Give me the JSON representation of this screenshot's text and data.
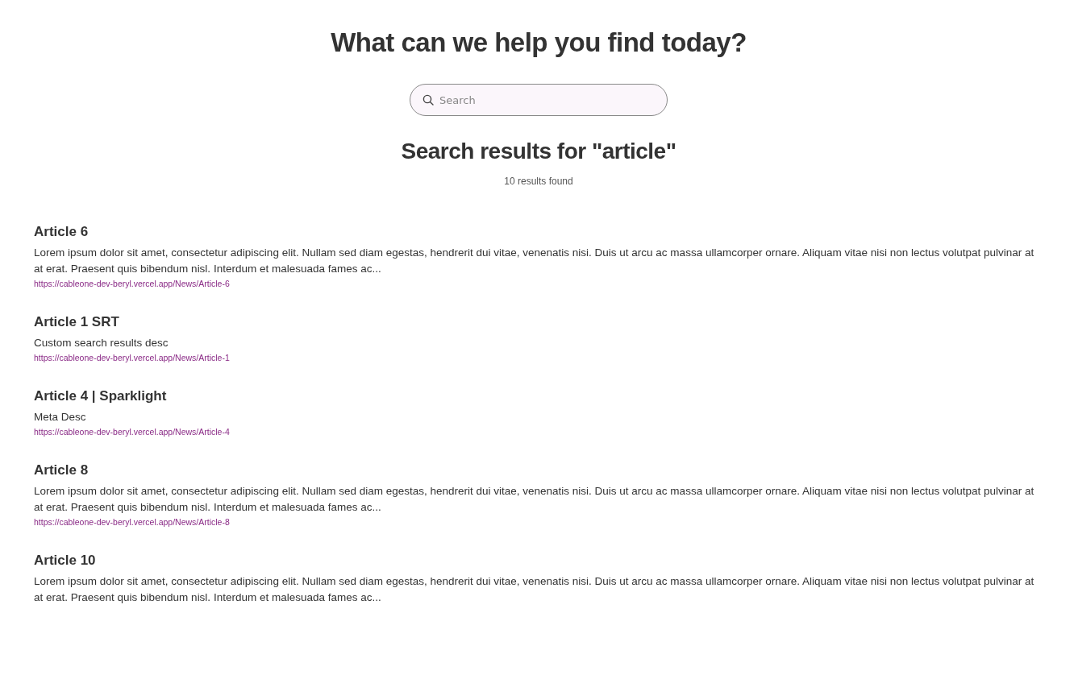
{
  "heading": "What can we help you find today?",
  "search": {
    "placeholder": "Search"
  },
  "results_heading": "Search results for \"article\"",
  "results_count": "10 results found",
  "results": [
    {
      "title": "Article 6",
      "description": "Lorem ipsum dolor sit amet, consectetur adipiscing elit. Nullam sed diam egestas, hendrerit dui vitae, venenatis nisi. Duis ut arcu ac massa ullamcorper ornare. Aliquam vitae nisi non lectus volutpat pulvinar at at erat. Praesent quis bibendum nisl. Interdum et malesuada fames ac...",
      "url": "https://cableone-dev-beryl.vercel.app/News/Article-6"
    },
    {
      "title": "Article 1 SRT",
      "description": "Custom search results desc",
      "url": "https://cableone-dev-beryl.vercel.app/News/Article-1"
    },
    {
      "title": "Article 4 | Sparklight",
      "description": "Meta Desc",
      "url": "https://cableone-dev-beryl.vercel.app/News/Article-4"
    },
    {
      "title": "Article 8",
      "description": "Lorem ipsum dolor sit amet, consectetur adipiscing elit. Nullam sed diam egestas, hendrerit dui vitae, venenatis nisi. Duis ut arcu ac massa ullamcorper ornare. Aliquam vitae nisi non lectus volutpat pulvinar at at erat. Praesent quis bibendum nisl. Interdum et malesuada fames ac...",
      "url": "https://cableone-dev-beryl.vercel.app/News/Article-8"
    },
    {
      "title": "Article 10",
      "description": "Lorem ipsum dolor sit amet, consectetur adipiscing elit. Nullam sed diam egestas, hendrerit dui vitae, venenatis nisi. Duis ut arcu ac massa ullamcorper ornare. Aliquam vitae nisi non lectus volutpat pulvinar at at erat. Praesent quis bibendum nisl. Interdum et malesuada fames ac..."
    }
  ]
}
